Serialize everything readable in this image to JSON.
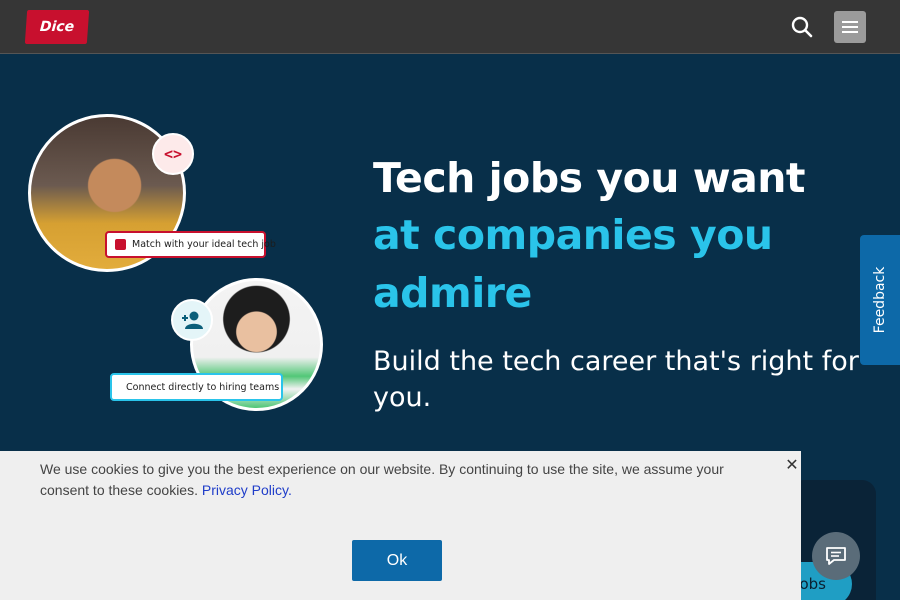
{
  "header": {
    "logo_text": "Dice",
    "search_icon": "search-icon",
    "menu_icon": "hamburger-icon"
  },
  "hero": {
    "headline_line1": "Tech jobs you want",
    "headline_line2": "at companies you",
    "headline_line3": "admire",
    "subheadline": "Build the tech career that's right for you.",
    "code_icon_glyph": "<>",
    "pill_match": "Match with your ideal tech job",
    "pill_connect": "Connect directly to hiring teams"
  },
  "feedback_tab": {
    "label": "Feedback"
  },
  "partial_button": {
    "label": "obs"
  },
  "cookie_banner": {
    "text": "We use cookies to give you the best experience on our website. By continuing to use the site, we assume your consent to these cookies. ",
    "link_label": "Privacy Policy.",
    "close_glyph": "✕",
    "ok_label": "Ok"
  },
  "colors": {
    "hero_bg": "#082f49",
    "accent_cyan": "#2ac4ea",
    "brand_red": "#c8102e",
    "button_blue": "#0d69a8",
    "header_bg": "#363636"
  }
}
